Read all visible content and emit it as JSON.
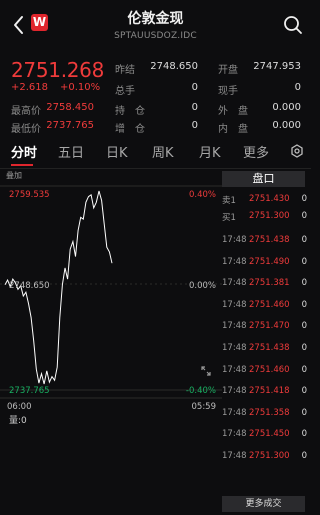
{
  "header": {
    "title": "伦敦金现",
    "subtitle": "SPTAUUSDOZ.IDC",
    "logo_text": "W"
  },
  "quote": {
    "price": "2751.268",
    "change": "+2.618",
    "change_pct": "+0.10%",
    "stats": [
      {
        "label": "昨结",
        "value": "2748.650",
        "label2": "开盘",
        "value2": "2747.953"
      },
      {
        "label": "总手",
        "value": "0",
        "label2": "现手",
        "value2": "0"
      }
    ],
    "rows": [
      {
        "l1": "最高价",
        "v1": "2758.450",
        "l2": "持　仓",
        "v2": "0",
        "l3": "外　盘",
        "v3": "0.000"
      },
      {
        "l1": "最低价",
        "v1": "2737.765",
        "l2": "增　仓",
        "v2": "0",
        "l3": "内　盘",
        "v3": "0.000"
      }
    ]
  },
  "tabs": [
    "分时",
    "五日",
    "日K",
    "周K",
    "月K",
    "更多"
  ],
  "chart": {
    "overlay_label": "叠加",
    "ymax_label": "2759.535",
    "ymid_label": "2748.650",
    "ymin_label": "2737.765",
    "pct_top": "0.40%",
    "pct_mid": "0.00%",
    "pct_bot": "-0.40%",
    "x_start": "06:00",
    "x_end": "05:59",
    "amount_label": "量:0"
  },
  "chart_data": {
    "type": "line",
    "ylim": [
      2737.765,
      2759.535
    ],
    "y": [
      2749.0,
      2749.5,
      2748.8,
      2749.6,
      2749.2,
      2748.5,
      2748.9,
      2747.8,
      2748.2,
      2747.0,
      2745.5,
      2743.0,
      2740.0,
      2738.5,
      2739.5,
      2738.4,
      2739.8,
      2738.6,
      2739.2,
      2738.8,
      2740.2,
      2745.5,
      2749.0,
      2750.8,
      2749.6,
      2752.8,
      2753.6,
      2752.0,
      2754.8,
      2756.2,
      2756.0,
      2757.8,
      2758.4,
      2758.6,
      2757.2,
      2757.8,
      2759.0,
      2758.0,
      2755.5,
      2753.0,
      2752.5,
      2751.3
    ]
  },
  "order_book": {
    "header": "盘口",
    "rows": [
      {
        "time": "卖1",
        "price": "2751.430",
        "vol": "0"
      },
      {
        "time": "买1",
        "price": "2751.300",
        "vol": "0"
      }
    ]
  },
  "trades": [
    {
      "time": "17:48",
      "price": "2751.438",
      "vol": "0"
    },
    {
      "time": "17:48",
      "price": "2751.490",
      "vol": "0"
    },
    {
      "time": "17:48",
      "price": "2751.381",
      "vol": "0"
    },
    {
      "time": "17:48",
      "price": "2751.460",
      "vol": "0"
    },
    {
      "time": "17:48",
      "price": "2751.470",
      "vol": "0"
    },
    {
      "time": "17:48",
      "price": "2751.438",
      "vol": "0"
    },
    {
      "time": "17:48",
      "price": "2751.460",
      "vol": "0"
    },
    {
      "time": "17:48",
      "price": "2751.418",
      "vol": "0"
    },
    {
      "time": "17:48",
      "price": "2751.358",
      "vol": "0"
    },
    {
      "time": "17:48",
      "price": "2751.450",
      "vol": "0"
    },
    {
      "time": "17:48",
      "price": "2751.300",
      "vol": "0"
    }
  ],
  "more_trades_label": "更多成交",
  "colors": {
    "up": "#ef3b3b",
    "down": "#19b062",
    "accent": "#e0262d",
    "line": "#ffffff"
  }
}
